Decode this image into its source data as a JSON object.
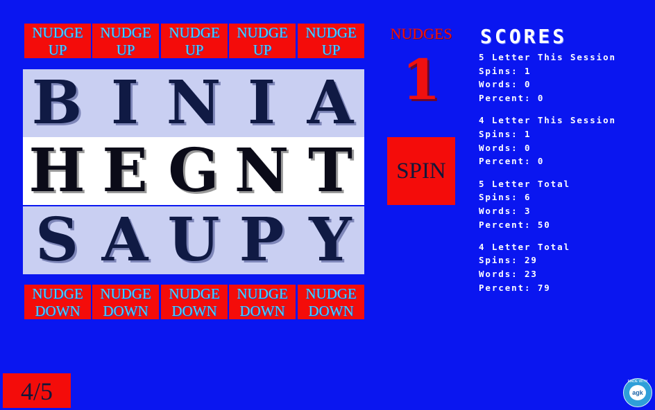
{
  "nudge_up": [
    {
      "line1": "NUDGE",
      "line2": "UP"
    },
    {
      "line1": "NUDGE",
      "line2": "UP"
    },
    {
      "line1": "NUDGE",
      "line2": "UP"
    },
    {
      "line1": "NUDGE",
      "line2": "UP"
    },
    {
      "line1": "NUDGE",
      "line2": "UP"
    }
  ],
  "reels": [
    [
      "B",
      "I",
      "N",
      "I",
      "A"
    ],
    [
      "H",
      "E",
      "G",
      "N",
      "T"
    ],
    [
      "S",
      "A",
      "U",
      "P",
      "Y"
    ]
  ],
  "nudge_down": [
    {
      "line1": "NUDGE",
      "line2": "DOWN"
    },
    {
      "line1": "NUDGE",
      "line2": "DOWN"
    },
    {
      "line1": "NUDGE",
      "line2": "DOWN"
    },
    {
      "line1": "NUDGE",
      "line2": "DOWN"
    },
    {
      "line1": "NUDGE",
      "line2": "DOWN"
    }
  ],
  "nudges": {
    "label": "NUDGES",
    "count": "1"
  },
  "spin_label": "SPIN",
  "scores": {
    "title": "SCORES",
    "sections": [
      {
        "heading": "5 Letter This Session",
        "spins": "Spins: 1",
        "words": "Words: 0",
        "percent": "Percent: 0"
      },
      {
        "heading": "4 Letter This Session",
        "spins": "Spins: 1",
        "words": "Words: 0",
        "percent": "Percent: 0"
      },
      {
        "heading": "5 Letter Total",
        "spins": "Spins: 6",
        "words": "Words: 3",
        "percent": "Percent: 50"
      },
      {
        "heading": "4 Letter Total",
        "spins": "Spins: 29",
        "words": "Words: 23",
        "percent": "Percent: 79"
      }
    ]
  },
  "round_indicator": "4/5",
  "badge": {
    "top_text": "MADE WITH",
    "logo_text": "agk"
  },
  "colors": {
    "background": "#0a16f0",
    "button": "#f40c0a",
    "nudge_text": "#4bd5ff",
    "highlight_row": "#ffffff",
    "reel_row": "#c9cff2",
    "nudges_text": "#f01010",
    "score_text": "#ffffff"
  }
}
